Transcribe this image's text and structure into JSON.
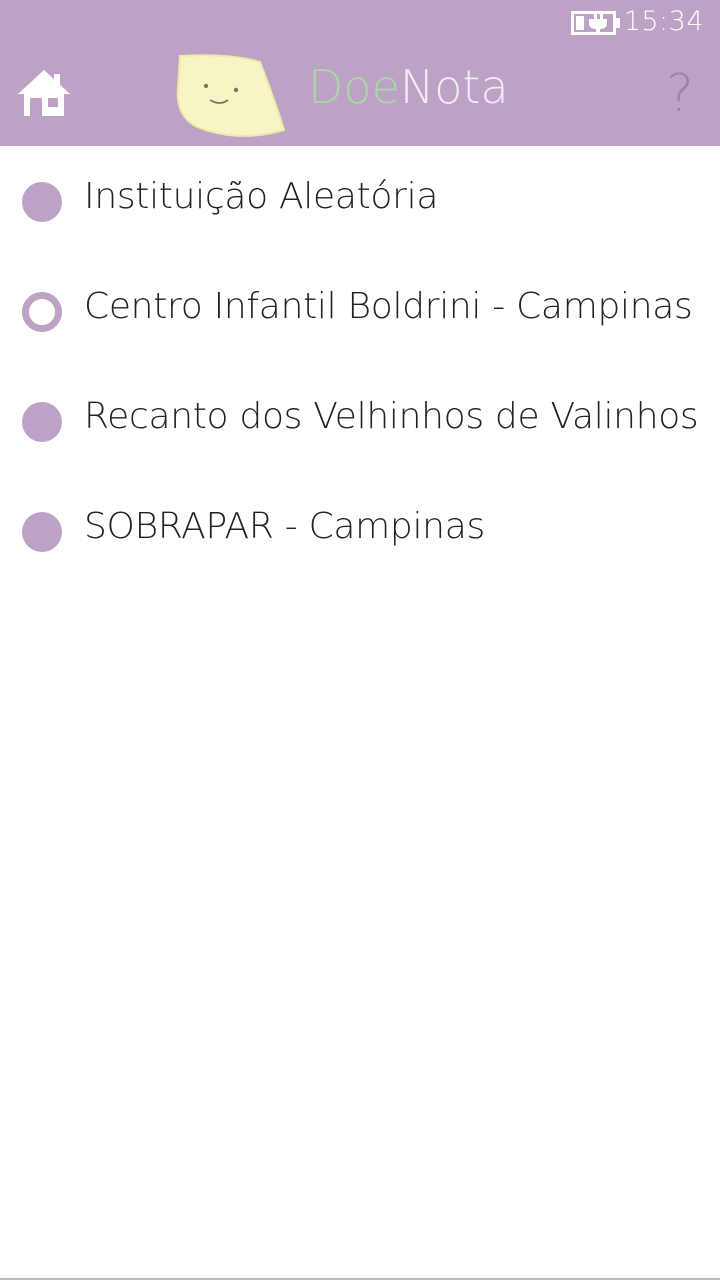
{
  "status_bar": {
    "time": "15:34",
    "battery_icon": "battery-charging-icon"
  },
  "header": {
    "background_color": "#bda2c5",
    "home_icon": "home-icon",
    "logo_icon": "smiling-note-icon",
    "title_part1": "Doe",
    "title_part2": "Nota",
    "title_part1_color": "#a8d8a4",
    "title_part2_color": "#f2ecf4",
    "help_label": "?"
  },
  "institutions": {
    "items": [
      {
        "label": "Instituição Aleatória",
        "selected": false
      },
      {
        "label": "Centro Infantil Boldrini - Campinas",
        "selected": true
      },
      {
        "label": "Recanto dos Velhinhos de Valinhos",
        "selected": false
      },
      {
        "label": "SOBRAPAR - Campinas",
        "selected": false
      }
    ]
  }
}
